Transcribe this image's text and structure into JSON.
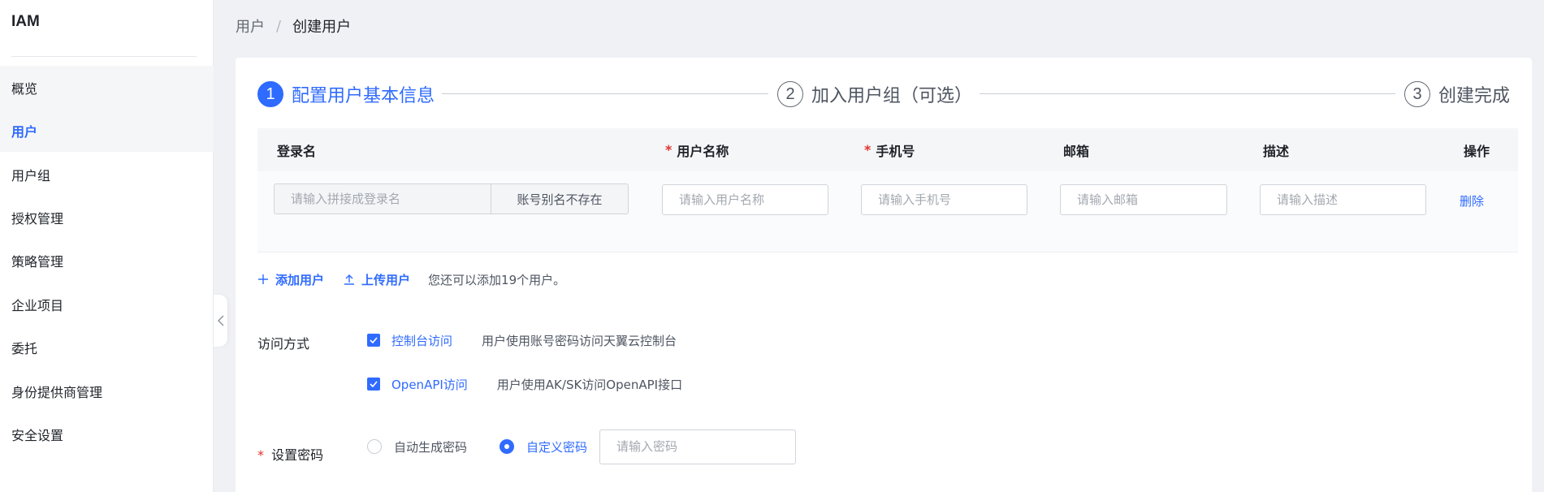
{
  "app": {
    "title": "IAM"
  },
  "sidebar": {
    "items": [
      {
        "label": "概览"
      },
      {
        "label": "用户"
      },
      {
        "label": "用户组"
      },
      {
        "label": "授权管理"
      },
      {
        "label": "策略管理"
      },
      {
        "label": "企业项目"
      },
      {
        "label": "委托"
      },
      {
        "label": "身份提供商管理"
      },
      {
        "label": "安全设置"
      }
    ],
    "active_index": 1
  },
  "breadcrumb": {
    "parent": "用户",
    "separator": "/",
    "current": "创建用户"
  },
  "steps": [
    {
      "number": "1",
      "label": "配置用户基本信息",
      "active": true
    },
    {
      "number": "2",
      "label": "加入用户组（可选）",
      "active": false
    },
    {
      "number": "3",
      "label": "创建完成",
      "active": false
    }
  ],
  "table": {
    "columns": {
      "login": "登录名",
      "username": "用户名称",
      "phone": "手机号",
      "email": "邮箱",
      "description": "描述",
      "operation": "操作"
    },
    "required_mark": "*",
    "row": {
      "login_placeholder": "请输入拼接成登录名",
      "login_suffix": "账号别名不存在",
      "username_placeholder": "请输入用户名称",
      "phone_placeholder": "请输入手机号",
      "email_placeholder": "请输入邮箱",
      "description_placeholder": "请输入描述",
      "delete_label": "删除"
    }
  },
  "actions": {
    "add_user": "添加用户",
    "upload_user": "上传用户",
    "hint": "您还可以添加19个用户。"
  },
  "access": {
    "label": "访问方式",
    "options": [
      {
        "label": "控制台访问",
        "desc": "用户使用账号密码访问天翼云控制台",
        "checked": true
      },
      {
        "label": "OpenAPI访问",
        "desc": "用户使用AK/SK访问OpenAPI接口",
        "checked": true
      }
    ]
  },
  "password": {
    "required_mark": "*",
    "label": "设置密码",
    "auto_label": "自动生成密码",
    "custom_label": "自定义密码",
    "selected": "custom",
    "placeholder": "请输入密码"
  },
  "colors": {
    "accent": "#2f6bff",
    "required": "#e0322e"
  }
}
